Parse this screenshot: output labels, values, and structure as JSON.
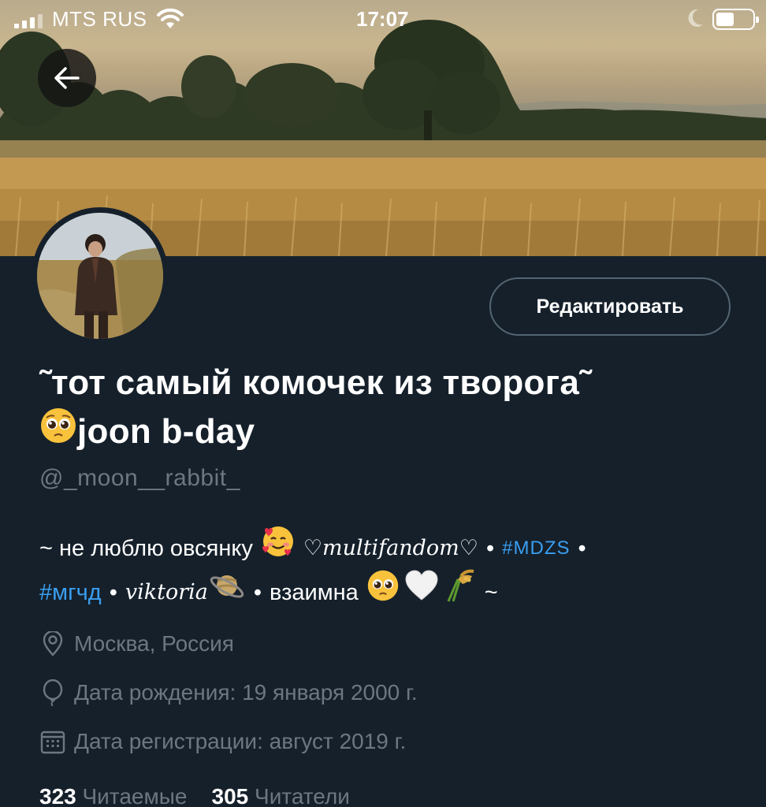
{
  "status_bar": {
    "carrier": "MTS RUS",
    "time": "17:07"
  },
  "profile": {
    "edit_button": "Редактировать",
    "name_line1": "˜тот самый комочек из творога˜",
    "name_line2": "joon b-day",
    "handle": "@_moon__rabbit_",
    "bio": {
      "part1": "~ не люблю овсянку",
      "multifandom": "♡multifandom♡",
      "dot": "•",
      "tag_mdzs": "#MDZS",
      "tag_mgchd": "#мгчд",
      "viktoria": "viktoria",
      "mutual": "взаимна",
      "tail": "~"
    },
    "location": "Москва, Россия",
    "birthday": "Дата рождения: 19 января 2000 г.",
    "joined": "Дата регистрации: август 2019 г.",
    "following_count": "323",
    "following_label": "Читаемые",
    "followers_count": "305",
    "followers_label": "Читатели"
  },
  "colors": {
    "background": "#15202b",
    "accent": "#3a9ef0",
    "secondary_text": "#6e7781"
  },
  "icons": [
    "back-arrow-icon",
    "location-pin-icon",
    "balloon-icon",
    "calendar-icon",
    "wifi-icon",
    "moon-icon",
    "battery-icon"
  ]
}
